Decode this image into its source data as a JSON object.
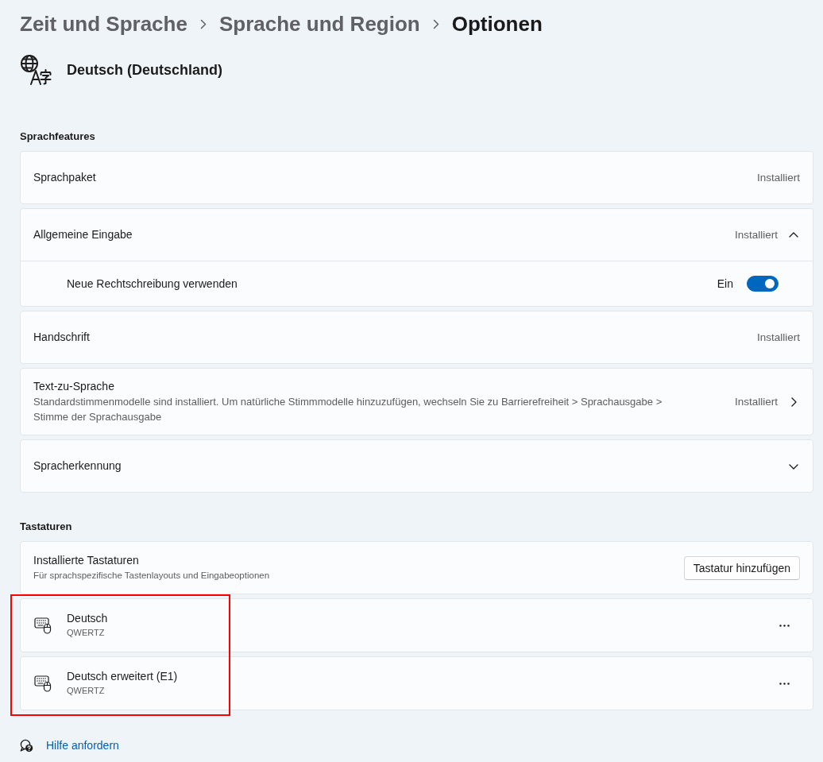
{
  "breadcrumb": [
    {
      "label": "Zeit und Sprache",
      "current": false
    },
    {
      "label": "Sprache und Region",
      "current": false
    },
    {
      "label": "Optionen",
      "current": true
    }
  ],
  "language": {
    "name": "Deutsch (Deutschland)"
  },
  "sections": [
    {
      "heading": "Sprachfeatures",
      "items": [
        {
          "kind": "status",
          "label": "Sprachpaket",
          "status": "Installiert"
        },
        {
          "kind": "expander",
          "label": "Allgemeine Eingabe",
          "status": "Installiert",
          "expanded": true,
          "children": [
            {
              "kind": "toggle",
              "label": "Neue Rechtschreibung verwenden",
              "state_label": "Ein",
              "on": true
            }
          ]
        },
        {
          "kind": "status",
          "label": "Handschrift",
          "status": "Installiert"
        },
        {
          "kind": "link",
          "label": "Text-zu-Sprache",
          "description": "Standardstimmenmodelle sind installiert. Um natürliche Stimmmodelle hinzuzufügen, wechseln Sie zu Barrierefreiheit > Sprachausgabe > Stimme der Sprachausgabe",
          "status": "Installiert"
        },
        {
          "kind": "expander",
          "label": "Spracherkennung",
          "expanded": false
        }
      ]
    },
    {
      "heading": "Tastaturen",
      "items": [
        {
          "kind": "action",
          "label": "Installierte Tastaturen",
          "description": "Für sprachspezifische Tastenlayouts und Eingabeoptionen",
          "button": "Tastatur hinzufügen",
          "highlighted": false
        },
        {
          "kind": "keyboard",
          "label": "Deutsch",
          "description": "QWERTZ",
          "highlighted": true
        },
        {
          "kind": "keyboard",
          "label": "Deutsch erweitert (E1)",
          "description": "QWERTZ",
          "highlighted": true
        }
      ]
    }
  ],
  "help_link": {
    "label": "Hilfe anfordern"
  }
}
